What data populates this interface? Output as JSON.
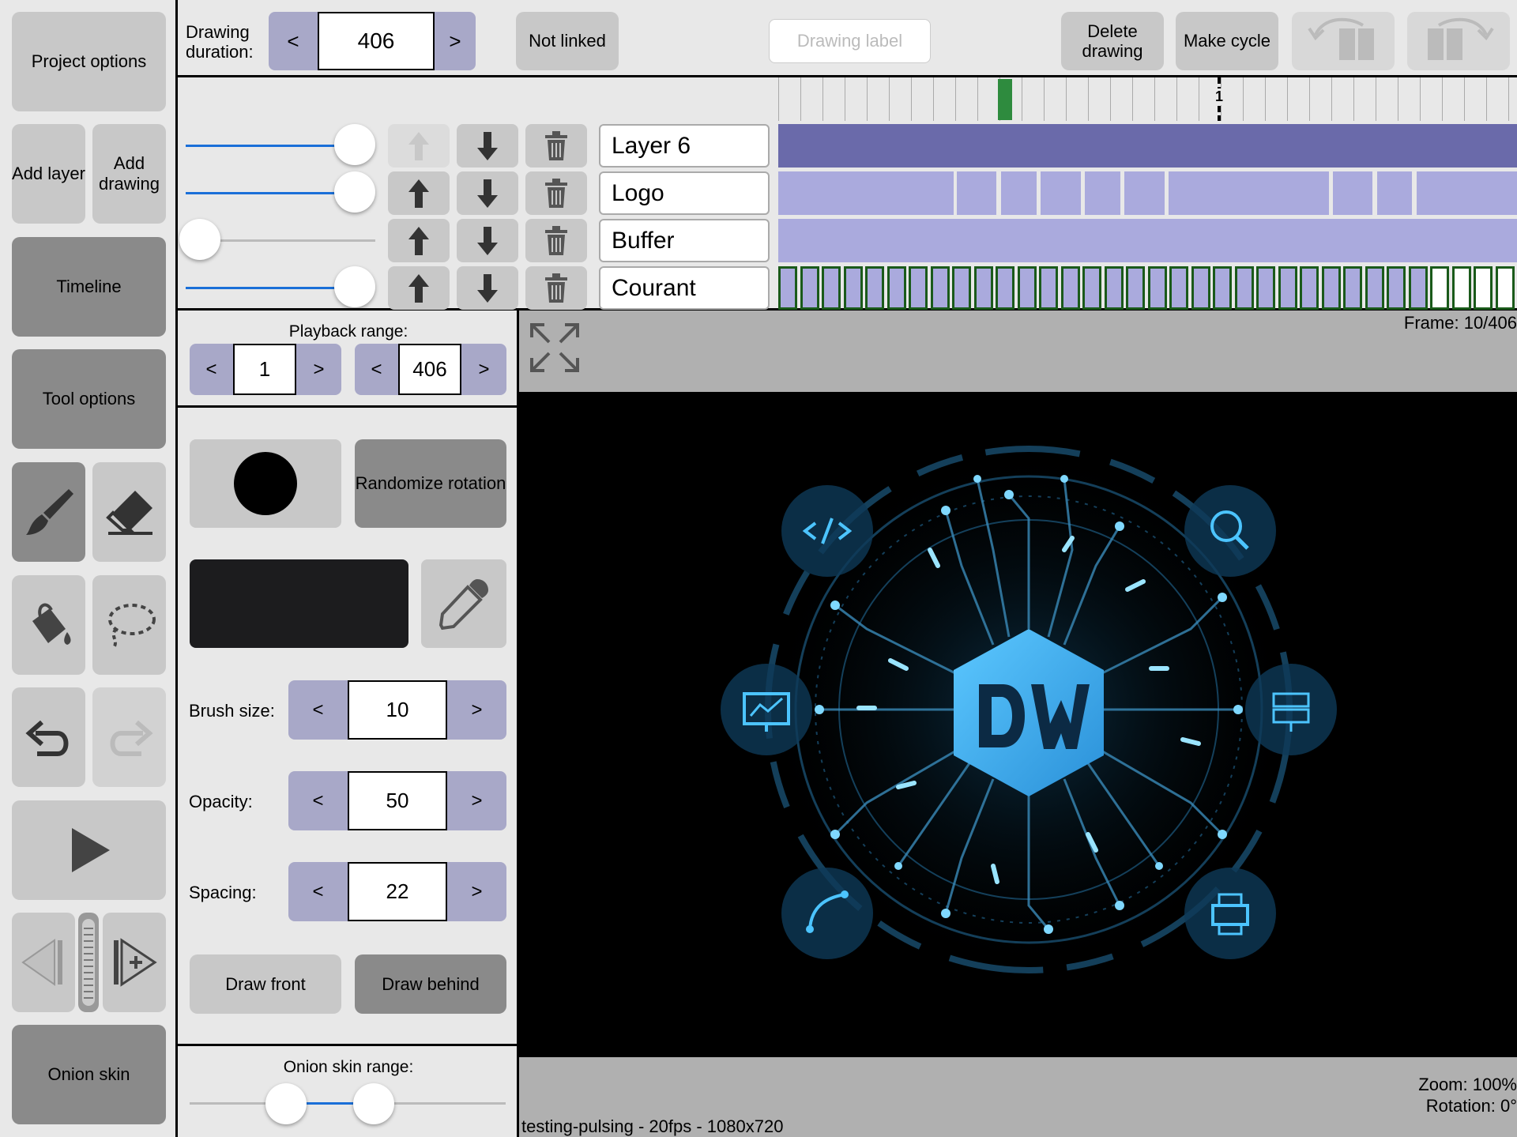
{
  "sidebar": {
    "project_options": "Project options",
    "add_layer": "Add layer",
    "add_drawing": "Add drawing",
    "timeline": "Timeline",
    "tool_options": "Tool options",
    "onion_skin": "Onion skin"
  },
  "topbar": {
    "drawing_duration_label": "Drawing duration:",
    "drawing_duration_value": "406",
    "not_linked": "Not linked",
    "drawing_label_placeholder": "Drawing label",
    "delete_drawing": "Delete drawing",
    "make_cycle": "Make cycle"
  },
  "timeline": {
    "current_marker": "1",
    "layers": [
      {
        "name": "Layer 6",
        "opacity": 0.85
      },
      {
        "name": "Logo",
        "opacity": 0.85
      },
      {
        "name": "Buffer",
        "opacity": 0.0
      },
      {
        "name": "Courant",
        "opacity": 0.85
      }
    ]
  },
  "tool_options": {
    "playback_range_label": "Playback range:",
    "playback_start": "1",
    "playback_end": "406",
    "randomize_rotation": "Randomize rotation",
    "brush_size_label": "Brush size:",
    "brush_size": "10",
    "opacity_label": "Opacity:",
    "opacity": "50",
    "spacing_label": "Spacing:",
    "spacing": "22",
    "draw_front": "Draw front",
    "draw_behind": "Draw behind",
    "onion_skin_range_label": "Onion skin range:",
    "color_swatch": "#1c1c1e"
  },
  "canvas": {
    "frame_readout": "Frame: 10/406",
    "project_info": "testing-pulsing - 20fps - 1080x720",
    "zoom": "Zoom: 100%",
    "rotation": "Rotation: 0°"
  },
  "colors": {
    "spinner": "#a8a8c8",
    "layer6_track": "#6a6aaa",
    "logo_track": "#aaaadd",
    "accent": "#1a6fd8",
    "logo_blue": "#3ab0f0"
  }
}
